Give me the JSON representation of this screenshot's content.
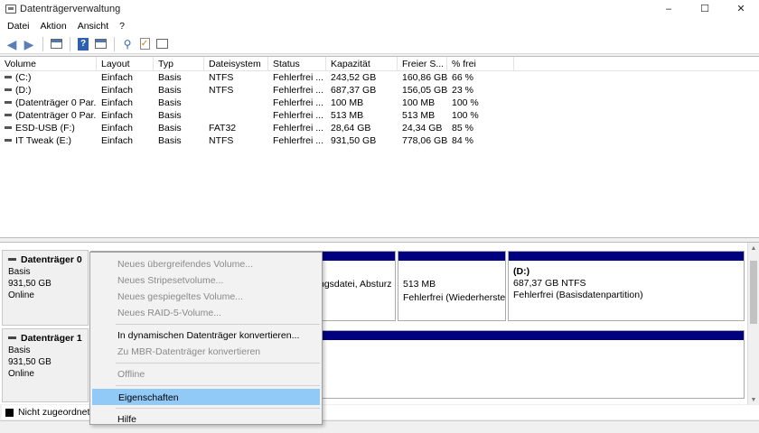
{
  "window": {
    "title": "Datenträgerverwaltung",
    "controls": [
      "–",
      "☐",
      "✕"
    ]
  },
  "menu": [
    "Datei",
    "Aktion",
    "Ansicht",
    "?"
  ],
  "toolbar": {
    "icons": [
      "back-icon",
      "forward-icon",
      "window-icon",
      "help-icon",
      "window2-icon",
      "key-icon",
      "checklist-icon",
      "list-icon"
    ]
  },
  "table": {
    "headers": [
      "Volume",
      "Layout",
      "Typ",
      "Dateisystem",
      "Status",
      "Kapazität",
      "Freier S...",
      "% frei"
    ],
    "rows": [
      [
        "(C:)",
        "Einfach",
        "Basis",
        "NTFS",
        "Fehlerfrei ...",
        "243,52 GB",
        "160,86 GB",
        "66 %"
      ],
      [
        "(D:)",
        "Einfach",
        "Basis",
        "NTFS",
        "Fehlerfrei ...",
        "687,37 GB",
        "156,05 GB",
        "23 %"
      ],
      [
        "(Datenträger 0 Par...",
        "Einfach",
        "Basis",
        "",
        "Fehlerfrei ...",
        "100 MB",
        "100 MB",
        "100 %"
      ],
      [
        "(Datenträger 0 Par...",
        "Einfach",
        "Basis",
        "",
        "Fehlerfrei ...",
        "513 MB",
        "513 MB",
        "100 %"
      ],
      [
        "ESD-USB (F:)",
        "Einfach",
        "Basis",
        "FAT32",
        "Fehlerfrei ...",
        "28,64 GB",
        "24,34 GB",
        "85 %"
      ],
      [
        "IT Tweak (E:)",
        "Einfach",
        "Basis",
        "NTFS",
        "Fehlerfrei ...",
        "931,50 GB",
        "778,06 GB",
        "84 %"
      ]
    ]
  },
  "disks": [
    {
      "name": "Datenträger 0",
      "type": "Basis",
      "size": "931,50 GB",
      "state": "Online"
    },
    {
      "name": "Datenträger 1",
      "type": "Basis",
      "size": "931,50 GB",
      "state": "Online"
    }
  ],
  "partitions": {
    "p_hidden": {
      "line2": "ngsdatei, Absturz"
    },
    "p_recovery": {
      "line1": "513 MB",
      "line2": "Fehlerfrei (Wiederherstel"
    },
    "p_d": {
      "line1": "(D:)",
      "line2": "687,37 GB NTFS",
      "line3": "Fehlerfrei (Basisdatenpartition)"
    }
  },
  "legend": {
    "unallocated": "Nicht zugeordnet"
  },
  "context_menu": {
    "items": [
      {
        "label": "Neues übergreifendes Volume...",
        "disabled": true
      },
      {
        "label": "Neues Stripesetvolume...",
        "disabled": true
      },
      {
        "label": "Neues gespiegeltes Volume...",
        "disabled": true
      },
      {
        "label": "Neues RAID-5-Volume...",
        "disabled": true
      },
      {
        "label": "In dynamischen Datenträger konvertieren...",
        "disabled": false
      },
      {
        "label": "Zu MBR-Datenträger konvertieren",
        "disabled": true
      },
      {
        "label": "Offline",
        "disabled": true
      },
      {
        "label": "Eigenschaften",
        "disabled": false,
        "highlighted": true
      },
      {
        "label": "Hilfe",
        "disabled": false
      }
    ]
  },
  "colors": {
    "partition_bar": "#000080",
    "menu_highlight": "#91c9f7"
  }
}
